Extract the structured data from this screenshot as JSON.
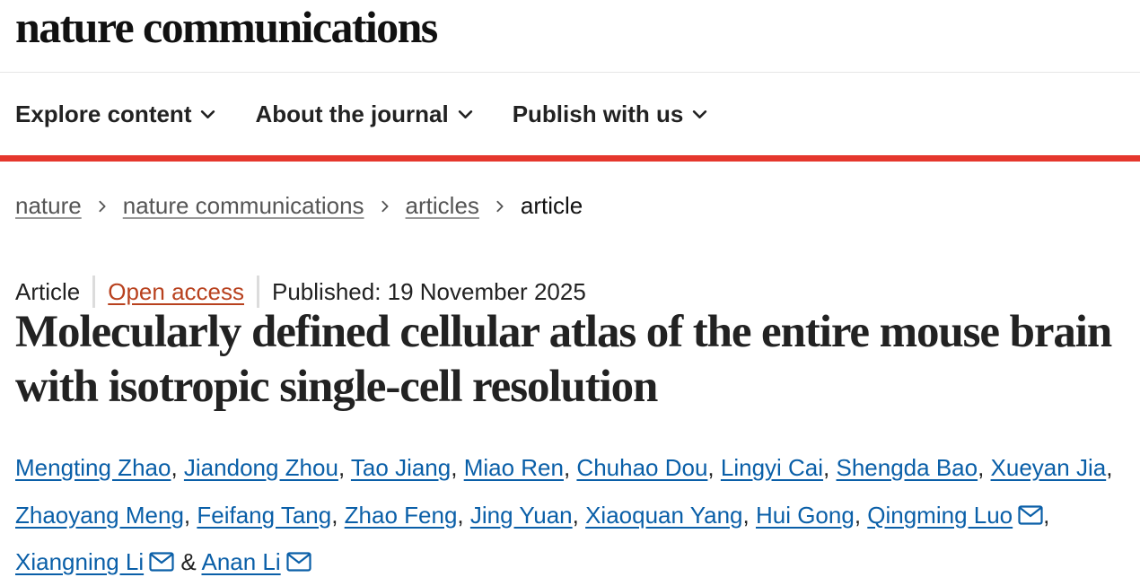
{
  "site": {
    "logo": "nature communications"
  },
  "nav": {
    "items": [
      {
        "label": "Explore content"
      },
      {
        "label": "About the journal"
      },
      {
        "label": "Publish with us"
      }
    ]
  },
  "breadcrumb": {
    "items": [
      "nature",
      "nature communications",
      "articles"
    ],
    "current": "article"
  },
  "article": {
    "type": "Article",
    "access": "Open access",
    "published": "Published: 19 November 2025",
    "title": "Molecularly defined cellular atlas of the entire mouse brain with isotropic single-cell resolution",
    "authors": [
      {
        "name": "Mengting Zhao",
        "email_icon": false
      },
      {
        "name": "Jiandong Zhou",
        "email_icon": false
      },
      {
        "name": "Tao Jiang",
        "email_icon": false
      },
      {
        "name": "Miao Ren",
        "email_icon": false
      },
      {
        "name": "Chuhao Dou",
        "email_icon": false
      },
      {
        "name": "Lingyi Cai",
        "email_icon": false
      },
      {
        "name": "Shengda Bao",
        "email_icon": false
      },
      {
        "name": "Xueyan Jia",
        "email_icon": false
      },
      {
        "name": "Zhaoyang Meng",
        "email_icon": false
      },
      {
        "name": "Feifang Tang",
        "email_icon": false
      },
      {
        "name": "Zhao Feng",
        "email_icon": false
      },
      {
        "name": "Jing Yuan",
        "email_icon": false
      },
      {
        "name": "Xiaoquan Yang",
        "email_icon": false
      },
      {
        "name": "Hui Gong",
        "email_icon": false
      },
      {
        "name": "Qingming Luo",
        "email_icon": true
      },
      {
        "name": "Xiangning Li",
        "email_icon": true
      },
      {
        "name": "Anan Li",
        "email_icon": true
      }
    ],
    "author_separator": ", ",
    "last_separator": " & "
  },
  "colors": {
    "accent_red": "#e5372d",
    "link_blue": "#0a5fa8",
    "open_access_orange": "#b8411e"
  },
  "icons": {
    "nav_chevron": "chevron-down-icon",
    "breadcrumb_separator": "chevron-right-icon",
    "author_email": "envelope-icon"
  }
}
